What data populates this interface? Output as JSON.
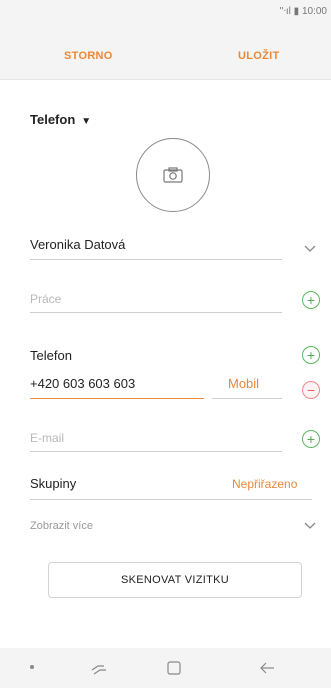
{
  "status_bar": {
    "text": "''ᐧıl ▮ 10:00"
  },
  "action_bar": {
    "cancel": "STORNO",
    "save": "ULOŽIT"
  },
  "account": {
    "label": "Telefon"
  },
  "fields": {
    "name": "Veronika Datová",
    "work_placeholder": "Práce",
    "phone_label": "Telefon",
    "phone_value": "+420 603 603 603",
    "phone_type": "Mobil",
    "email_placeholder": "E-mail",
    "groups_label": "Skupiny",
    "groups_value": "Nepřiřazeno",
    "show_more": "Zobrazit více"
  },
  "scan_button": "SKENOVAT VIZITKU",
  "colors": {
    "accent": "#e8893a",
    "add": "#4caf50",
    "remove": "#e35c5c"
  },
  "icons": [
    "camera-icon",
    "add-icon",
    "remove-icon",
    "chevron-down-icon",
    "recent-apps-icon",
    "home-icon",
    "back-icon"
  ]
}
